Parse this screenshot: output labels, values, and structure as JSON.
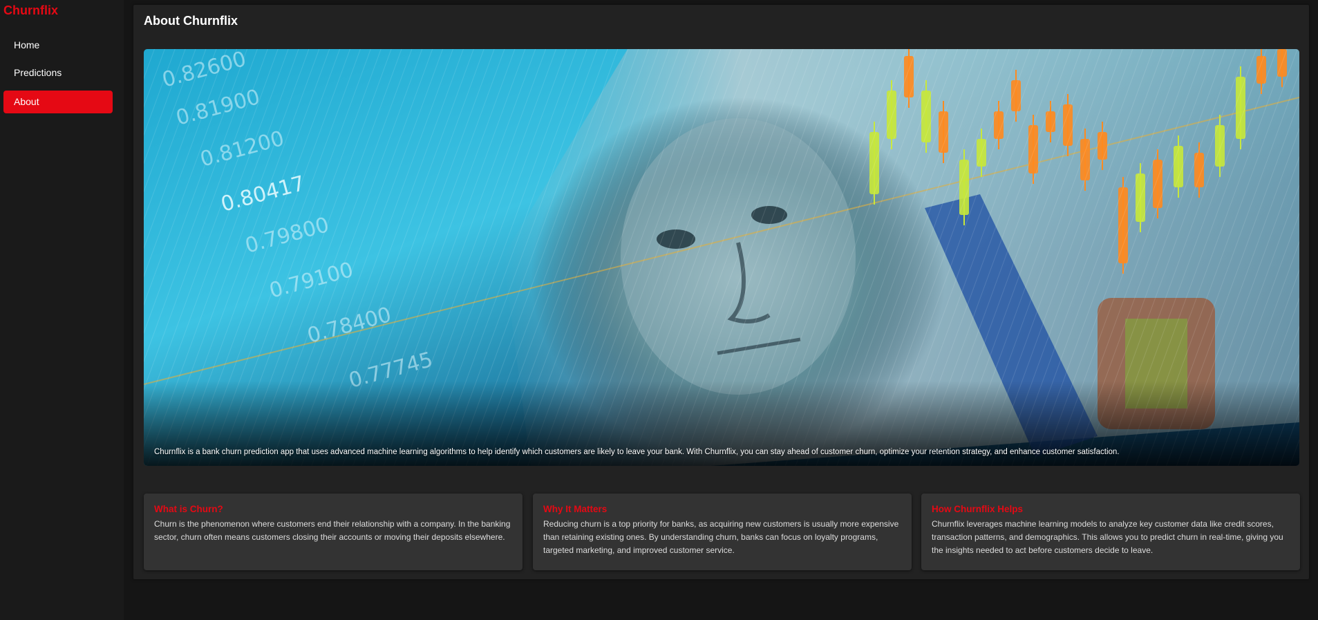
{
  "app": {
    "brand": "Churnflix"
  },
  "nav": {
    "items": [
      {
        "label": "Home",
        "active": false
      },
      {
        "label": "Predictions",
        "active": false
      },
      {
        "label": "About",
        "active": true
      }
    ]
  },
  "colors": {
    "accent": "#e50914",
    "sidebar_bg": "#1a1a1a",
    "main_bg": "#222222",
    "card_bg": "#333333"
  },
  "page": {
    "title": "About Churnflix",
    "hero": {
      "caption": "Churnflix is a bank churn prediction app that uses advanced machine learning algorithms to help identify which customers are likely to leave your bank. With Churnflix, you can stay ahead of customer churn, optimize your retention strategy, and enhance customer satisfaction.",
      "price_labels": [
        "0.82600",
        "0.81900",
        "0.81200",
        "0.80417",
        "0.79800",
        "0.79100",
        "0.78400",
        "0.77745"
      ]
    },
    "cards": [
      {
        "title": "What is Churn?",
        "body": "Churn is the phenomenon where customers end their relationship with a company. In the banking sector, churn often means customers closing their accounts or moving their deposits elsewhere."
      },
      {
        "title": "Why It Matters",
        "body": "Reducing churn is a top priority for banks, as acquiring new customers is usually more expensive than retaining existing ones. By understanding churn, banks can focus on loyalty programs, targeted marketing, and improved customer service."
      },
      {
        "title": "How Churnflix Helps",
        "body": "Churnflix leverages machine learning models to analyze key customer data like credit scores, transaction patterns, and demographics. This allows you to predict churn in real-time, giving you the insights needed to act before customers decide to leave."
      }
    ]
  }
}
